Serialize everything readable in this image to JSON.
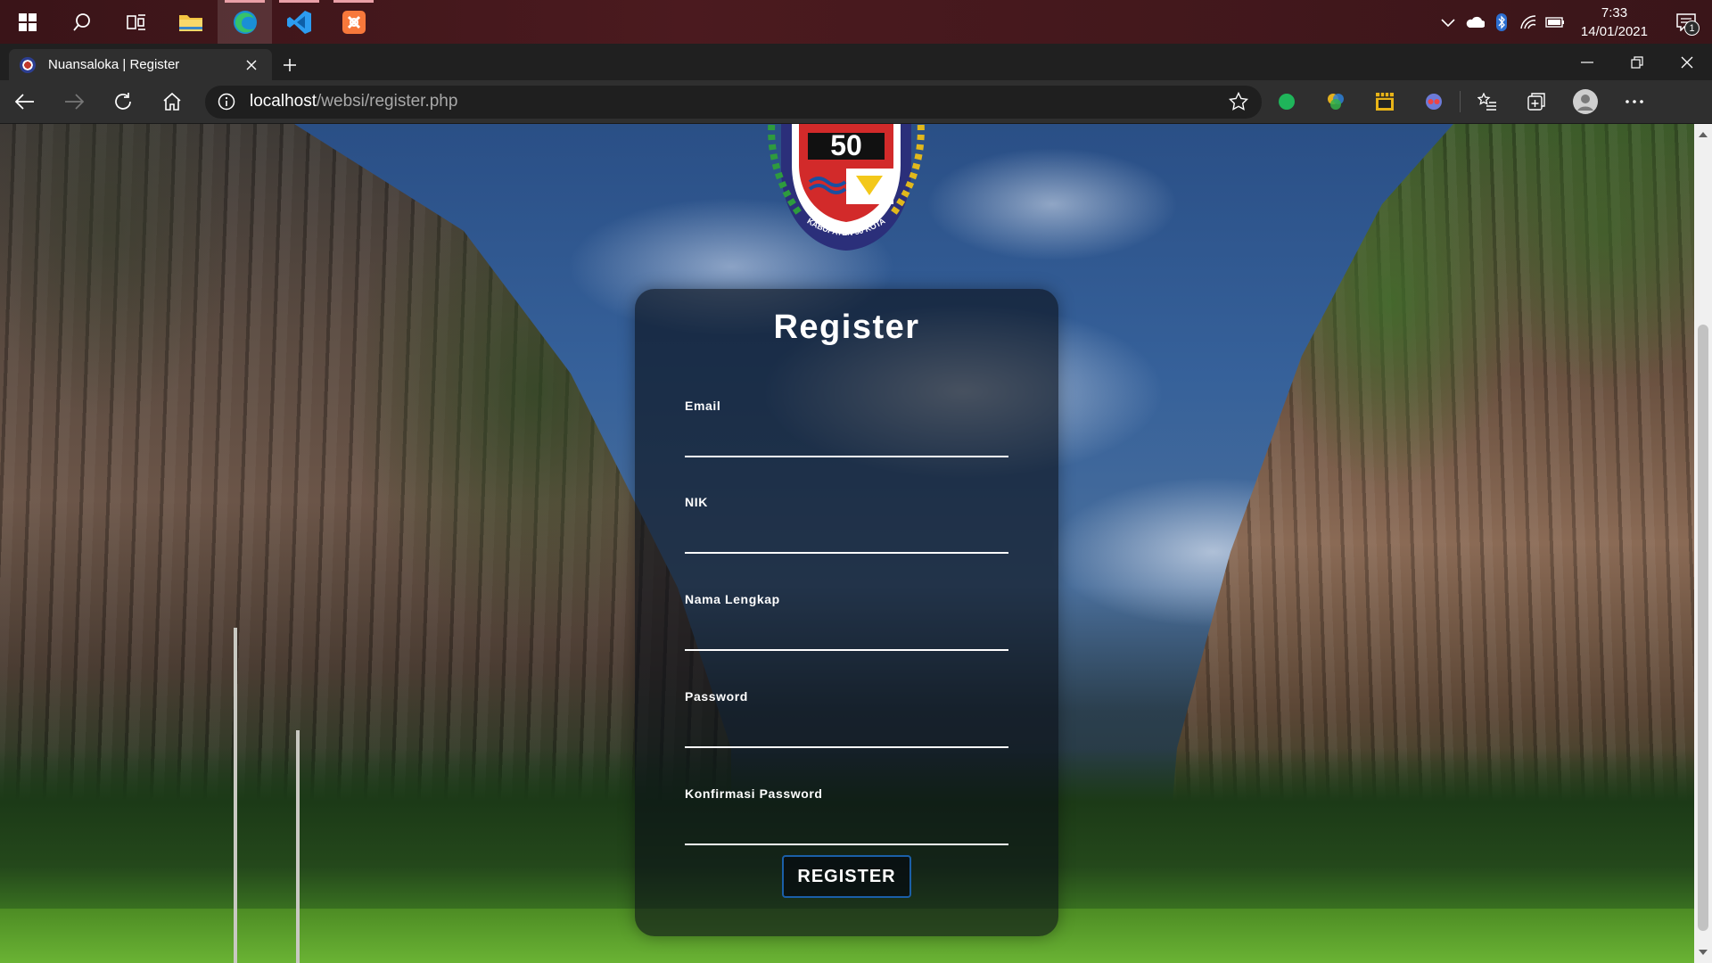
{
  "taskbar": {
    "clock_time": "7:33",
    "clock_date": "14/01/2021",
    "notification_count": "1"
  },
  "browser": {
    "tab_title": "Nuansaloka | Register",
    "address_host": "localhost",
    "address_path": "/websi/register.php"
  },
  "page": {
    "emblem_text": "50",
    "emblem_caption": "KABUPATEN 50 KOTA",
    "form_title": "Register",
    "fields": {
      "email_label": "Email",
      "nik_label": "NIK",
      "name_label": "Nama Lengkap",
      "password_label": "Password",
      "confirm_label": "Konfirmasi Password"
    },
    "submit_label": "REGISTER"
  }
}
